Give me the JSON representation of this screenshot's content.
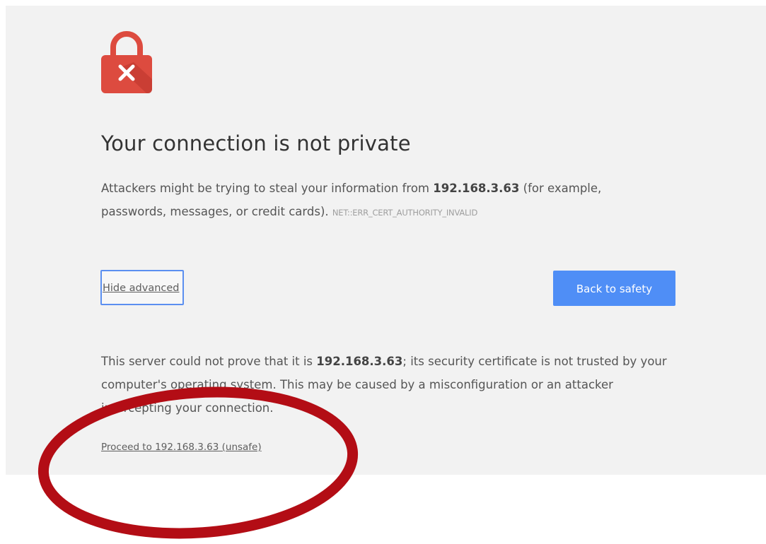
{
  "header": {
    "icon": "lock-error-icon",
    "title": "Your connection is not private"
  },
  "intro": {
    "before_host": "Attackers might be trying to steal your information from ",
    "host": "192.168.3.63",
    "after_host": " (for example, passwords, messages, or credit cards). ",
    "error_code": "NET::ERR_CERT_AUTHORITY_INVALID"
  },
  "actions": {
    "hide_advanced_label": "Hide advanced",
    "back_label": "Back to safety"
  },
  "details": {
    "before_host": "This server could not prove that it is ",
    "host": "192.168.3.63",
    "after_host": "; its security certificate is not trusted by your computer's operating system. This may be caused by a misconfiguration or an attacker intercepting your connection."
  },
  "proceed": {
    "label": "Proceed to 192.168.3.63 (unsafe)"
  },
  "colors": {
    "lock_red": "#dd4b3f",
    "button_blue": "#4f8ef6",
    "annotation_red": "#b30d15",
    "panel_bg": "#f2f2f2"
  }
}
